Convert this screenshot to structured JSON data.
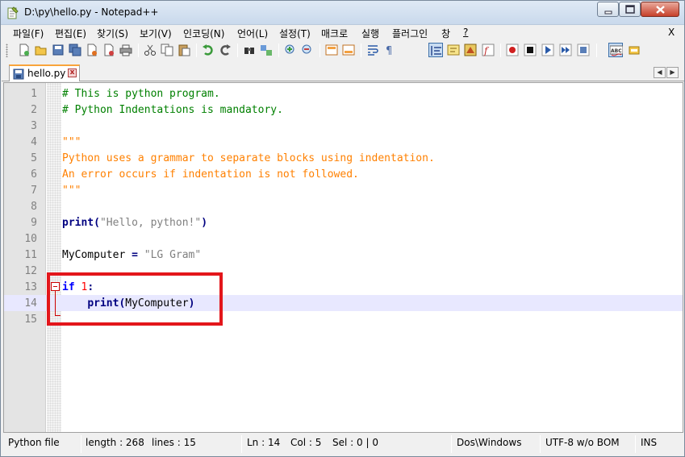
{
  "window": {
    "title": "D:\\py\\hello.py - Notepad++"
  },
  "menu": {
    "items": [
      "파일(F)",
      "편집(E)",
      "찾기(S)",
      "보기(V)",
      "인코딩(N)",
      "언어(L)",
      "설정(T)",
      "매크로",
      "실행",
      "플러그인",
      "창",
      "?"
    ],
    "close_label": "X"
  },
  "toolbar": {
    "icons": [
      "new-file-icon",
      "open-file-icon",
      "save-icon",
      "save-all-icon",
      "close-icon",
      "close-all-icon",
      "print-icon",
      "cut-icon",
      "copy-icon",
      "paste-icon",
      "undo-icon",
      "redo-icon",
      "find-icon",
      "replace-icon",
      "zoom-in-icon",
      "zoom-out-icon",
      "sync-vertical-icon",
      "sync-horizontal-icon",
      "word-wrap-icon",
      "show-all-chars-icon",
      "indent-guide-icon",
      "user-language-icon",
      "doc-map-icon",
      "function-list-icon",
      "record-macro-icon",
      "stop-macro-icon",
      "play-macro-icon",
      "run-macro-multiple-icon",
      "save-macro-icon",
      "spell-check-icon",
      "plugin-icon"
    ]
  },
  "tab": {
    "label": "hello.py",
    "close": "x"
  },
  "editor": {
    "current_line": 14,
    "lines": [
      {
        "n": "1",
        "text": "# This is python program.",
        "kind": "comment"
      },
      {
        "n": "2",
        "text": "# Python Indentations is mandatory.",
        "kind": "comment"
      },
      {
        "n": "3",
        "text": "",
        "kind": "plain"
      },
      {
        "n": "4",
        "text": "\"\"\"",
        "kind": "string"
      },
      {
        "n": "5",
        "text": "Python uses a grammar to separate blocks using indentation.",
        "kind": "string"
      },
      {
        "n": "6",
        "text": "An error occurs if indentation is not followed.",
        "kind": "string"
      },
      {
        "n": "7",
        "text": "\"\"\"",
        "kind": "string"
      },
      {
        "n": "8",
        "text": "",
        "kind": "plain"
      },
      {
        "n": "9",
        "text": "",
        "kind": "print_hello"
      },
      {
        "n": "10",
        "text": "",
        "kind": "plain"
      },
      {
        "n": "11",
        "text": "",
        "kind": "assign"
      },
      {
        "n": "12",
        "text": "",
        "kind": "plain"
      },
      {
        "n": "13",
        "text": "",
        "kind": "if"
      },
      {
        "n": "14",
        "text": "",
        "kind": "print_var"
      },
      {
        "n": "15",
        "text": "",
        "kind": "plain"
      }
    ],
    "tokens": {
      "print_kw": "print",
      "open_paren": "(",
      "close_paren": ")",
      "hello_str": "\"Hello, python!\"",
      "var_name": "MyComputer",
      "assign_op": " = ",
      "lg_str": "\"LG Gram\"",
      "if_kw": "if",
      "one": "1",
      "colon": ":",
      "indent": "    "
    }
  },
  "status": {
    "file_type": "Python file",
    "length": "length : 268",
    "lines": "lines : 15",
    "ln": "Ln : 14",
    "col": "Col : 5",
    "sel": "Sel : 0 | 0",
    "eol": "Dos\\Windows",
    "encoding": "UTF-8 w/o BOM",
    "mode": "INS"
  },
  "colors": {
    "comment": "#008000",
    "string": "#ff8000",
    "keyword": "#0000ff",
    "function": "#000080",
    "number": "#ff0000",
    "highlight_box": "#e3161b",
    "current_line": "#e8e8ff"
  }
}
